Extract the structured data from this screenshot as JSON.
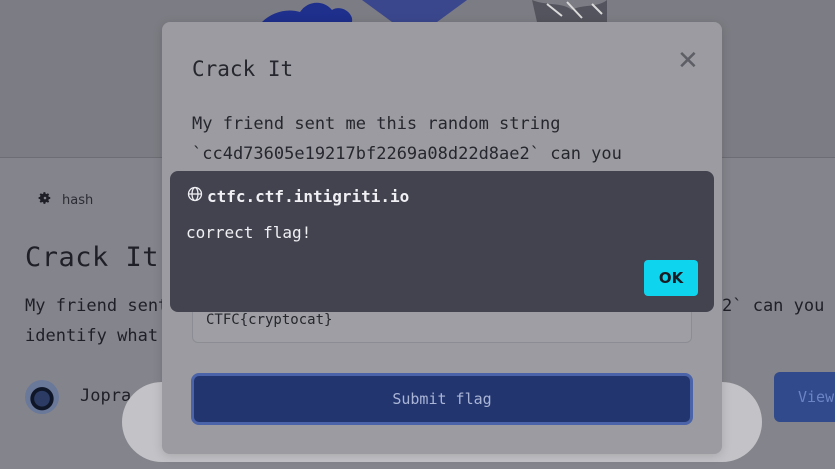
{
  "background_page": {
    "tag": {
      "icon": "gear-icon",
      "label": "hash"
    },
    "challenge_title": "Crack It",
    "description_line1_start": "My friend sent",
    "description_line1_end": "2` can you",
    "description_line2": "identify what",
    "author_name": "Jopra",
    "view_button_label": "View"
  },
  "modal": {
    "title": "Crack It",
    "close_icon": "close-icon",
    "description_line1": "My friend sent me this random string",
    "description_line2": "`cc4d73605e19217bf2269a08d22d8ae2` can you",
    "flag_input_value": "CTFC{cryptocat}",
    "submit_label": "Submit flag"
  },
  "alert": {
    "origin_icon": "globe-icon",
    "origin": "ctfc.ctf.intigriti.io",
    "message": "correct flag!",
    "ok_label": "OK"
  },
  "colors": {
    "accent": "#0fd4ee",
    "submit_bg": "#22356e",
    "alert_bg": "#434350"
  }
}
